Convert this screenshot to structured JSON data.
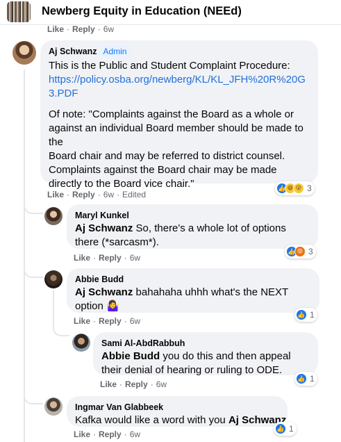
{
  "group": {
    "title": "Newberg Equity in Education (NEEd)"
  },
  "top_meta": {
    "like": "Like",
    "reply": "Reply",
    "time": "6w"
  },
  "comments": [
    {
      "author": "Aj Schwanz",
      "badge": "Admin",
      "line1": "This is the Public and Student Complaint Procedure:",
      "link": "https://policy.osba.org/newberg/KL/KL_JFH%20R%20G3.PDF",
      "note": "Of note: \"Complaints against the Board as a whole or against an individual Board member should be made to the\nBoard chair and may be referred to district counsel. Complaints against the Board chair may be made directly to the Board vice chair.\"",
      "like": "Like",
      "reply": "Reply",
      "time": "6w",
      "edited": "Edited",
      "reactions": {
        "icons": [
          "like-icon",
          "haha-icon",
          "wow-icon"
        ],
        "count": "3"
      }
    },
    {
      "author": "Maryl Kunkel",
      "mention": "Aj Schwanz",
      "text": "So, there's a whole lot of options there (*sarcasm*).",
      "like": "Like",
      "reply": "Reply",
      "time": "6w",
      "reactions": {
        "icons": [
          "like-icon",
          "angry-icon"
        ],
        "count": "3"
      }
    },
    {
      "author": "Abbie Budd",
      "mention": "Aj Schwanz",
      "text": "bahahaha uhhh what's the NEXT option",
      "emoji": "🤷‍♀️",
      "like": "Like",
      "reply": "Reply",
      "time": "6w",
      "reactions": {
        "icons": [
          "like-icon"
        ],
        "count": "1"
      }
    },
    {
      "author": "Sami Al-AbdRabbuh",
      "mention": "Abbie Budd",
      "text": "you do this and then appeal their denial of hearing or ruling to ODE.",
      "like": "Like",
      "reply": "Reply",
      "time": "6w",
      "reactions": {
        "icons": [
          "like-icon"
        ],
        "count": "1"
      }
    },
    {
      "author": "Ingmar Van Glabbeek",
      "text": "Kafka would like a word with you",
      "mention": "Aj Schwanz",
      "like": "Like",
      "reply": "Reply",
      "time": "6w",
      "reactions": {
        "icons": [
          "like-icon"
        ],
        "count": "1"
      }
    }
  ],
  "colors": {
    "link": "#216fdb",
    "like_blue": "#1877f2",
    "bubble": "#f0f2f5",
    "meta": "#65676b"
  }
}
